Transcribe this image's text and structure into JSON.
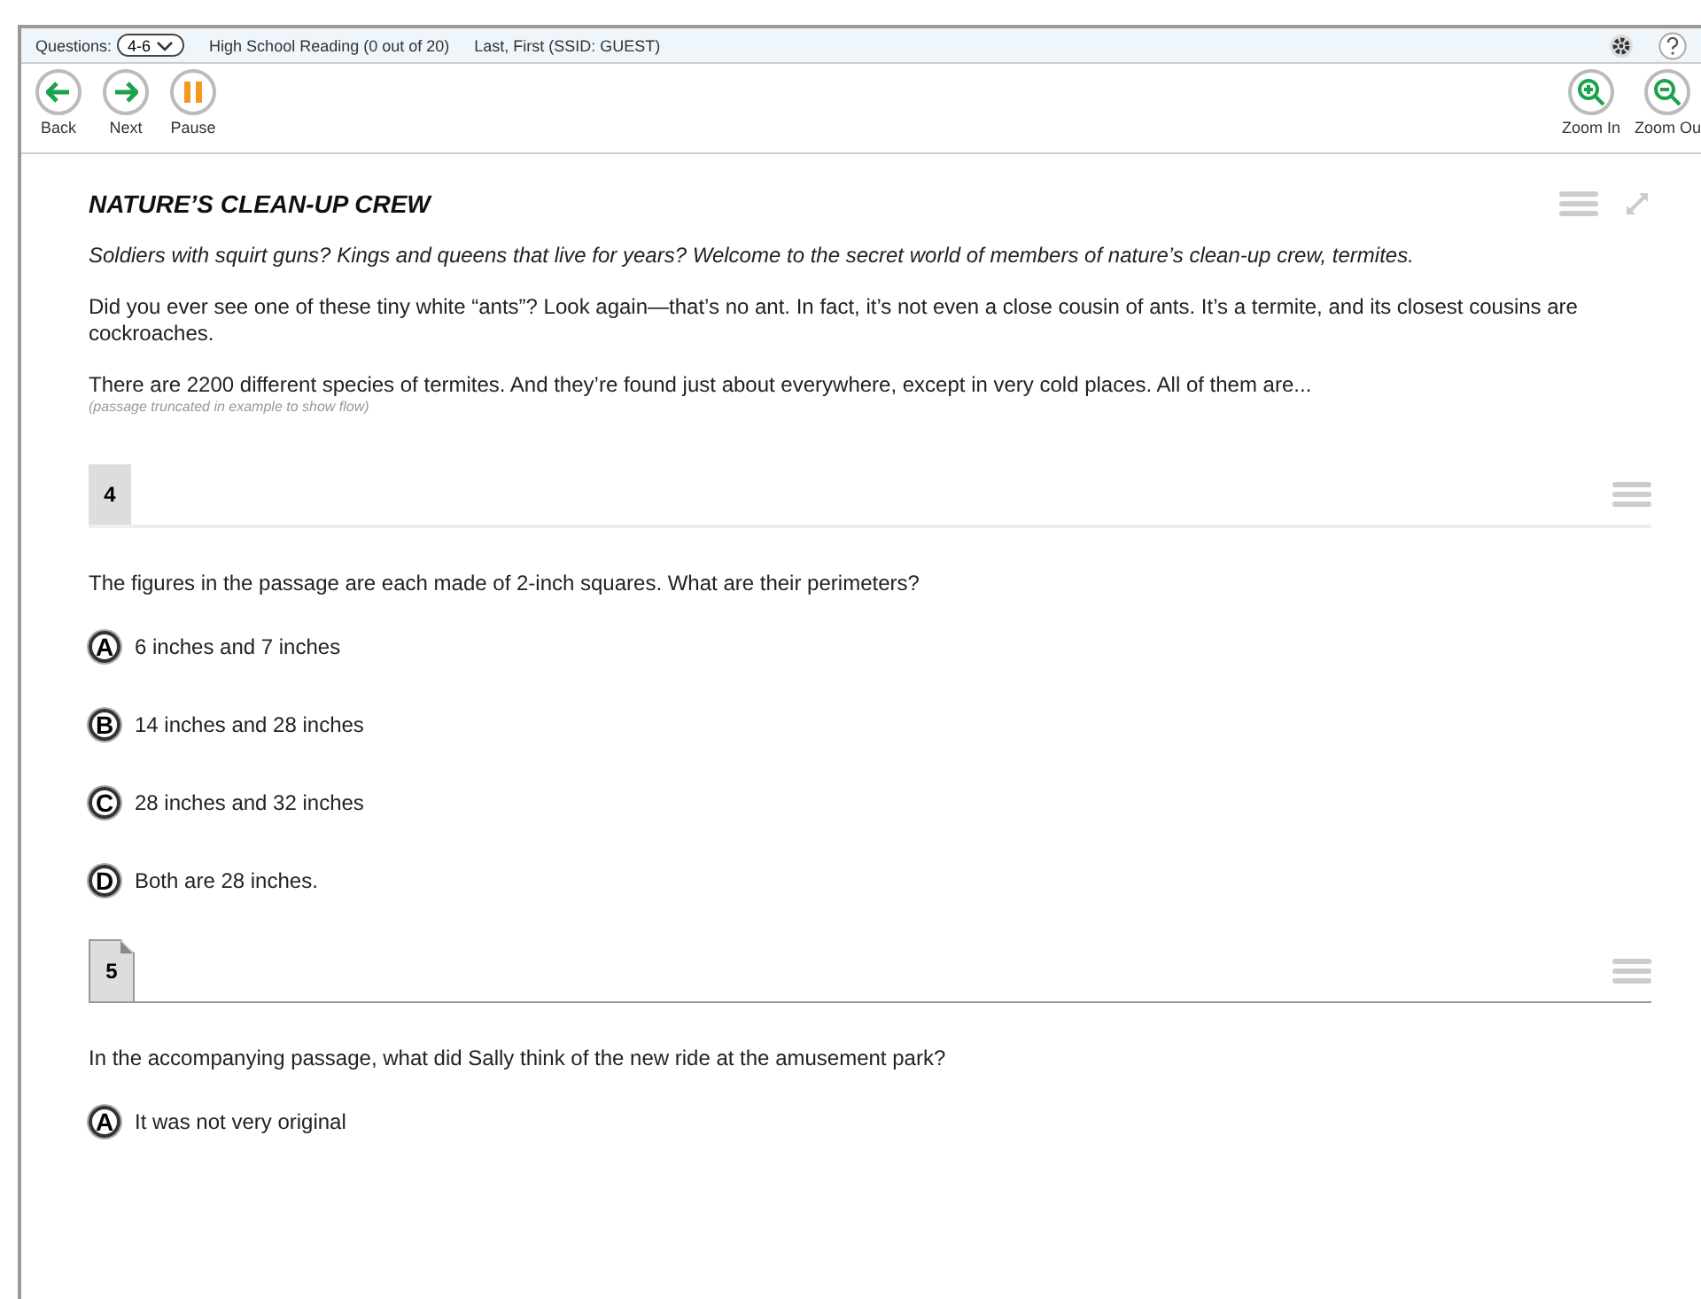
{
  "top_bar": {
    "questions_label": "Questions:",
    "questions_value": "4-6",
    "test_title": "High School Reading (0 out of 20)",
    "student": "Last, First (SSID: GUEST)"
  },
  "toolbar": {
    "left": [
      {
        "kind": "back",
        "label": "Back"
      },
      {
        "kind": "next",
        "label": "Next"
      },
      {
        "kind": "pause",
        "label": "Pause"
      }
    ],
    "right": [
      {
        "kind": "zoom_in",
        "label": "Zoom In"
      },
      {
        "kind": "zoom_out",
        "label": "Zoom Ou"
      }
    ]
  },
  "passage": {
    "title": "NATURE’S CLEAN-UP CREW",
    "paragraphs": [
      {
        "kind": "italic",
        "text": "Soldiers with squirt guns? Kings and queens that  live for years? Welcome to the secret world of  members of nature’s clean-up crew, termites."
      },
      {
        "kind": "plain",
        "text": "Did you ever see  one of these tiny white “ants”? Look again—that’s no ant. In fact, it’s not even a close cousin of ants. It’s a termite, and its closest cousins are cockroaches."
      },
      {
        "kind": "plain",
        "text": "There are 2200 different species of termites. And they’re found just about everywhere, except  in very cold places. All of them are..."
      }
    ],
    "note": "(passage truncated in example to show flow)"
  },
  "questions": [
    {
      "number": "4",
      "flagged": false,
      "prompt": "The figures in the passage are each made of 2-inch squares. What are their perimeters?",
      "options": [
        {
          "letter": "A",
          "text": "6 inches and 7 inches"
        },
        {
          "letter": "B",
          "text": "14 inches and 28 inches"
        },
        {
          "letter": "C",
          "text": "28 inches and 32 inches"
        },
        {
          "letter": "D",
          "text": "Both are 28 inches."
        }
      ]
    },
    {
      "number": "5",
      "flagged": true,
      "prompt": "In the accompanying passage, what did Sally think of the new ride at the amusement park?",
      "options": [
        {
          "letter": "A",
          "text": "It was not very original"
        }
      ]
    }
  ]
}
